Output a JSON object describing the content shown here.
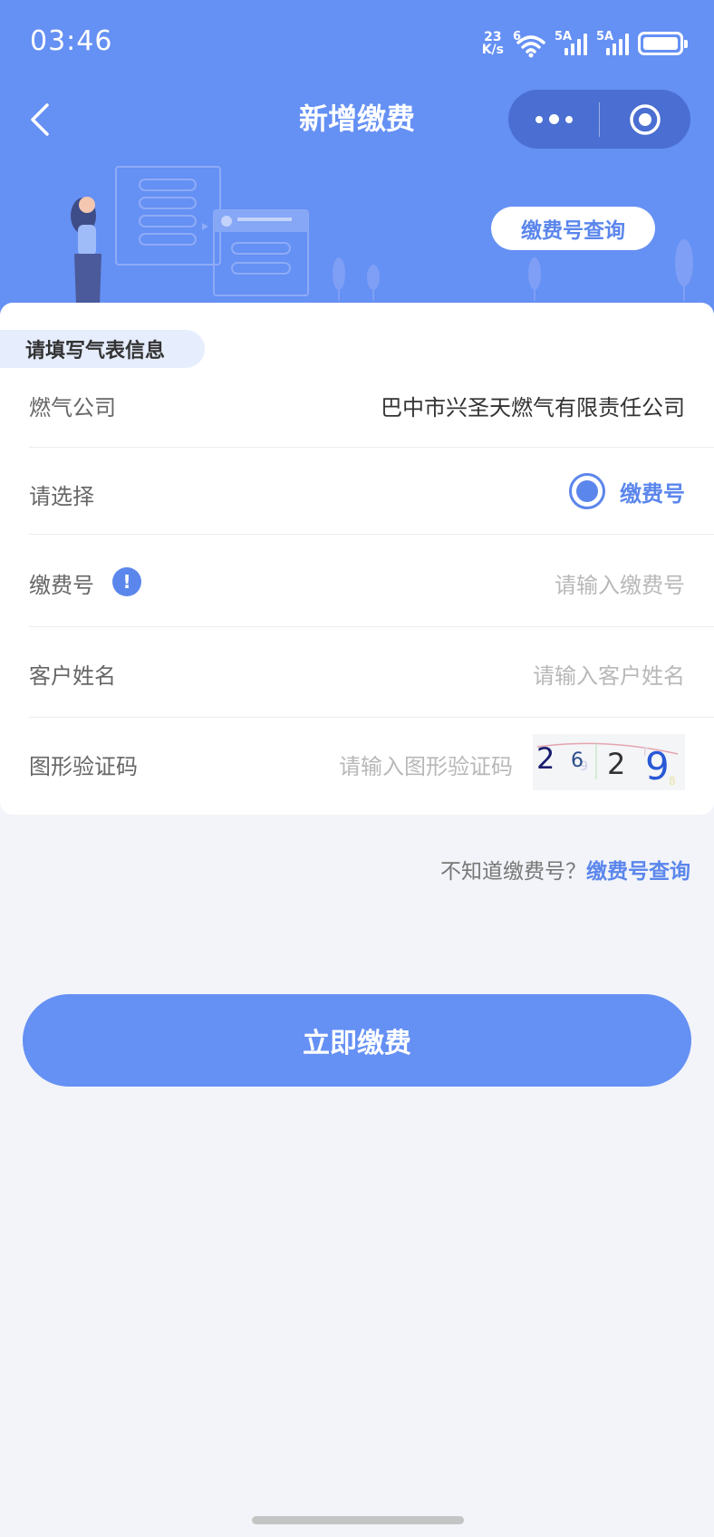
{
  "status_bar": {
    "time": "03:46",
    "net_speed_value": "23",
    "net_speed_unit": "K/s",
    "sim1_label": "5A",
    "sim2_label": "5A",
    "wifi_label": "6",
    "battery_level": 1.0
  },
  "nav": {
    "title": "新增缴费",
    "back_icon": "chevron-left-icon",
    "more_icon": "more-dots-icon",
    "target_icon": "target-icon"
  },
  "banner": {
    "query_button_label": "缴费号查询"
  },
  "form": {
    "section_title": "请填写气表信息",
    "company": {
      "label": "燃气公司",
      "value": "巴中市兴圣天燃气有限责任公司"
    },
    "select": {
      "label": "请选择",
      "option_label": "缴费号",
      "selected": true
    },
    "account": {
      "label": "缴费号",
      "placeholder": "请输入缴费号",
      "info_icon_text": "!"
    },
    "customer": {
      "label": "客户姓名",
      "placeholder": "请输入客户姓名"
    },
    "captcha": {
      "label": "图形验证码",
      "placeholder": "请输入图形验证码",
      "chars": [
        "2",
        "6",
        "2",
        "9"
      ],
      "char_colors": [
        "#1b1d6e",
        "#2b4d8a",
        "#333333",
        "#2a58d6"
      ]
    }
  },
  "hint": {
    "text": "不知道缴费号？",
    "link": "缴费号查询"
  },
  "actions": {
    "pay_label": "立即缴费"
  },
  "colors": {
    "primary": "#6590f4",
    "accent_text": "#5b86ec",
    "background": "#f2f4f9"
  }
}
